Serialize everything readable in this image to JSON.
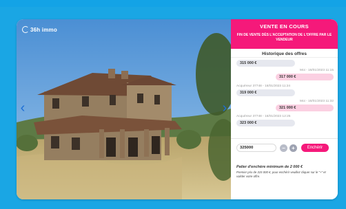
{
  "brand": {
    "logo_text": "36h immo"
  },
  "colors": {
    "accent": "#f5197a",
    "background": "#1aa6e4",
    "offer_own": "#fbd0e2",
    "offer_other": "#e6e8ef"
  },
  "gallery": {
    "prev_icon": "chevron-left-icon",
    "next_icon": "chevron-right-icon",
    "prev_glyph": "‹",
    "next_glyph": "›"
  },
  "sale": {
    "status": "VENTE EN COURS",
    "subtitle": "FIN DE VENTE DÈS L'ACCEPTATION DE L'OFFRE PAR LE VENDEUR"
  },
  "history": {
    "title": "Historique des offres",
    "offers": [
      {
        "meta": "",
        "amount": "315 000 €",
        "own": false
      },
      {
        "meta": "Moi - 16/01/2023 11:15",
        "amount": "317 000 €",
        "own": true
      },
      {
        "meta": "Acquéreur 37748 - 16/01/2023 11:24",
        "amount": "319 000 €",
        "own": false
      },
      {
        "meta": "Moi - 16/01/2023 11:32",
        "amount": "321 000 €",
        "own": true
      },
      {
        "meta": "Acquéreur 37748 - 16/01/2023 12:25",
        "amount": "323 000 €",
        "own": false
      }
    ]
  },
  "bid": {
    "value": "325000",
    "minus_label": "−",
    "plus_label": "+",
    "button_label": "Enchérir"
  },
  "info": {
    "min_step": "Palier d'enchère minimum de 2 000 €",
    "hint": "Premier prix de 315 000 €, pour enchérir veuillez cliquer sur le \"+\" et valider votre offre."
  }
}
